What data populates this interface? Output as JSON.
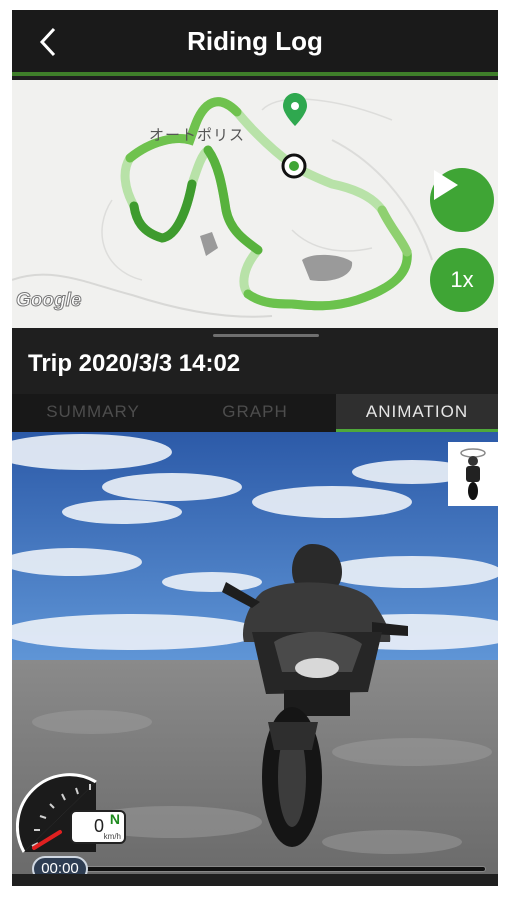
{
  "header": {
    "title": "Riding Log",
    "back_icon": "chevron-left-icon"
  },
  "map": {
    "place_label": "オートポリス",
    "google_logo": "Google",
    "play_icon": "play-icon",
    "speed_label": "1x",
    "accent": "#3fa535"
  },
  "trip": {
    "title": "Trip 2020/3/3 14:02"
  },
  "tabs": [
    {
      "label": "SUMMARY",
      "active": false
    },
    {
      "label": "GRAPH",
      "active": false
    },
    {
      "label": "ANIMATION",
      "active": true
    }
  ],
  "animation": {
    "speed_value": "0",
    "gear": "N",
    "speed_unit": "km/h",
    "time": "00:00",
    "progress": 0
  }
}
